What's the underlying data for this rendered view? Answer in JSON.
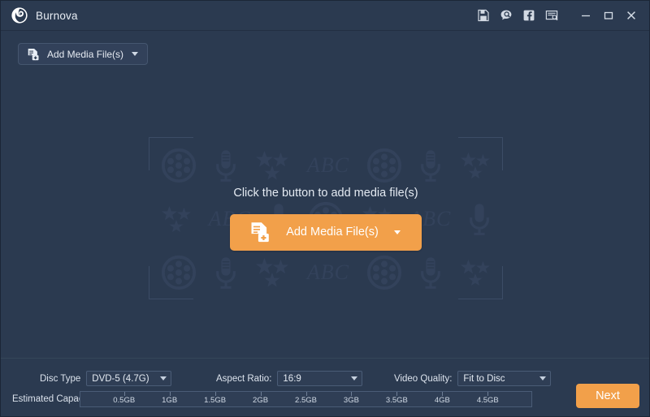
{
  "window": {
    "app_title": "Burnova",
    "logo_icon": "disc-swirl-logo-icon",
    "tools": [
      {
        "name": "register-icon",
        "title": "Register"
      },
      {
        "name": "help-search-icon",
        "title": "Help"
      },
      {
        "name": "facebook-icon",
        "title": "Facebook"
      },
      {
        "name": "feedback-icon",
        "title": "Feedback"
      }
    ],
    "controls": [
      {
        "name": "minimize-button",
        "label": "—"
      },
      {
        "name": "maximize-button",
        "label": "▭"
      },
      {
        "name": "close-button",
        "label": "✕"
      }
    ]
  },
  "toolbar": {
    "add_media_label": "Add Media File(s)",
    "dropdown_icon": "chevron-down-icon",
    "add_media_icon": "add-file-icon"
  },
  "dropzone": {
    "hint_text": "Click the button to add media file(s)",
    "primary_button_label": "Add Media File(s)",
    "primary_button_icon": "add-file-icon",
    "primary_button_caret": "chevron-down-icon",
    "watermark_icons": [
      "film-reel-icon",
      "microphone-icon",
      "stars-icon",
      "abc-text-icon"
    ],
    "watermark_abc": "ABC"
  },
  "settings": {
    "disc_type": {
      "label": "Disc Type",
      "value": "DVD-5 (4.7G)"
    },
    "aspect_ratio": {
      "label": "Aspect Ratio:",
      "value": "16:9"
    },
    "video_quality": {
      "label": "Video Quality:",
      "value": "Fit to Disc"
    }
  },
  "capacity": {
    "label": "Estimated Capacity:",
    "ticks": [
      "0.5GB",
      "1GB",
      "1.5GB",
      "2GB",
      "2.5GB",
      "3GB",
      "3.5GB",
      "4GB",
      "4.5GB"
    ],
    "used_fraction": 0
  },
  "footer": {
    "next_label": "Next"
  },
  "colors": {
    "accent": "#f2a04a",
    "window_bg": "#2b3a50",
    "text": "#e4eaf2",
    "watermark": "#33425b"
  }
}
